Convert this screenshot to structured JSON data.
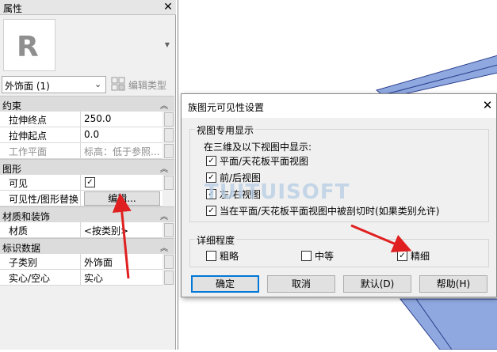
{
  "properties": {
    "title": "属性",
    "type_selector": {
      "value": "外饰面 (1)",
      "edit_type_label": "编辑类型"
    },
    "categories": {
      "constraints": "约束",
      "graphics": "图形",
      "materials": "材质和装饰",
      "identity": "标识数据"
    },
    "rows": {
      "extrusion_end": {
        "name": "拉伸终点",
        "value": "250.0"
      },
      "extrusion_start": {
        "name": "拉伸起点",
        "value": "0.0"
      },
      "work_plane": {
        "name": "工作平面",
        "value": "标高：低于参照..."
      },
      "visible": {
        "name": "可见"
      },
      "vis_override": {
        "name": "可见性/图形替换",
        "button": "编辑..."
      },
      "material": {
        "name": "材质",
        "value": "<按类别>"
      },
      "subcategory": {
        "name": "子类别",
        "value": "外饰面"
      },
      "solid_void": {
        "name": "实心/空心",
        "value": "实心"
      }
    }
  },
  "dialog": {
    "title": "族图元可见性设置",
    "view_group": {
      "label": "视图专用显示",
      "subtitle": "在三维及以下视图中显示:",
      "options": [
        {
          "label": "平面/天花板平面视图",
          "checked": true
        },
        {
          "label": "前/后视图",
          "checked": true
        },
        {
          "label": "左/右视图",
          "checked": true
        },
        {
          "label": "当在平面/天花板平面视图中被剖切时(如果类别允许)",
          "checked": true
        }
      ]
    },
    "detail_group": {
      "label": "详细程度",
      "options": [
        {
          "label": "粗略",
          "checked": false
        },
        {
          "label": "中等",
          "checked": false
        },
        {
          "label": "精细",
          "checked": true
        }
      ]
    },
    "buttons": {
      "ok": "确定",
      "cancel": "取消",
      "default": "默认(D)",
      "help": "帮助(H)"
    }
  },
  "watermark": "TUITUISOFT",
  "colors": {
    "accent": "#0078d7",
    "arrow": "#e02020",
    "model_face": "#8fa8e0"
  }
}
